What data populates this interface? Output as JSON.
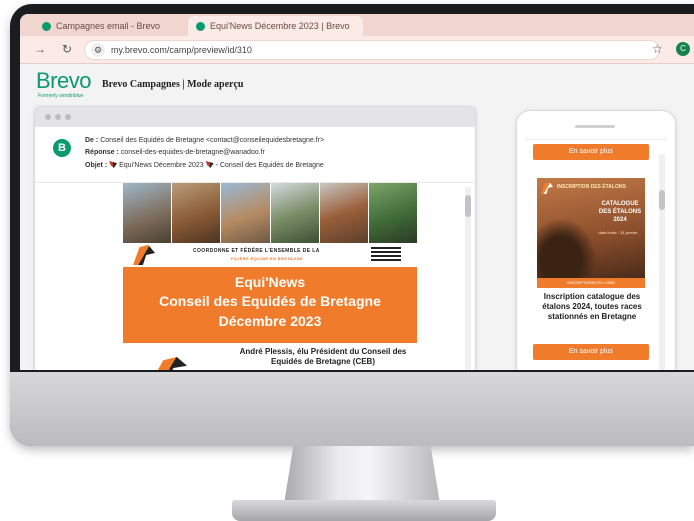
{
  "browser": {
    "tabs": [
      {
        "label": "Campagnes email - Brevo"
      },
      {
        "label": "Equi'News Décembre 2023 | Brevo"
      }
    ],
    "url": "my.brevo.com/camp/preview/id/310",
    "profile_initial": "C"
  },
  "app": {
    "logo": "Brevo",
    "logo_sub": "Formerly sendinblue",
    "page_title": "Brevo Campagnes | Mode aperçu"
  },
  "email_meta": {
    "from_label": "De :",
    "from_value": "Conseil des Equidés de Bretagne <contact@conseilequidesbretagne.fr>",
    "reply_label": "Réponse :",
    "reply_value": "conseil-des-equides-de-bretagne@wanadoo.fr",
    "subject_label": "Objet :",
    "subject_value": "Equi'News Décembre 2023",
    "subject_suffix": "- Conseil des Equidés de Bretagne",
    "avatar_letter": "B"
  },
  "email": {
    "tagline": "COORDONNE ET FÉDÈRE L'ENSEMBLE DE LA",
    "tagline2": "FILIÈRE ÉQUINE EN BRETAGNE",
    "title_line1": "Equi'News",
    "title_line2": "Conseil des Equidés de Bretagne",
    "title_line3": "Décembre 2023",
    "news_title": "André Plessis, élu Président du Conseil des Equidés de Bretagne (CEB)"
  },
  "mobile": {
    "button_label": "En savoir plus",
    "catalogue_head": "INSCRIPTION DES ÉTALONS",
    "catalogue_title": "CATALOGUE DES ÉTALONS 2024",
    "catalogue_dates": "date limite : 31 janvier",
    "catalogue_foot": "INSCRIPTIONS EN LIGNE",
    "caption": "Inscription catalogue des étalons 2024, toutes races stationnés en Bretagne"
  },
  "colors": {
    "brevo_green": "#0b996e",
    "email_orange": "#ef7b2b"
  }
}
